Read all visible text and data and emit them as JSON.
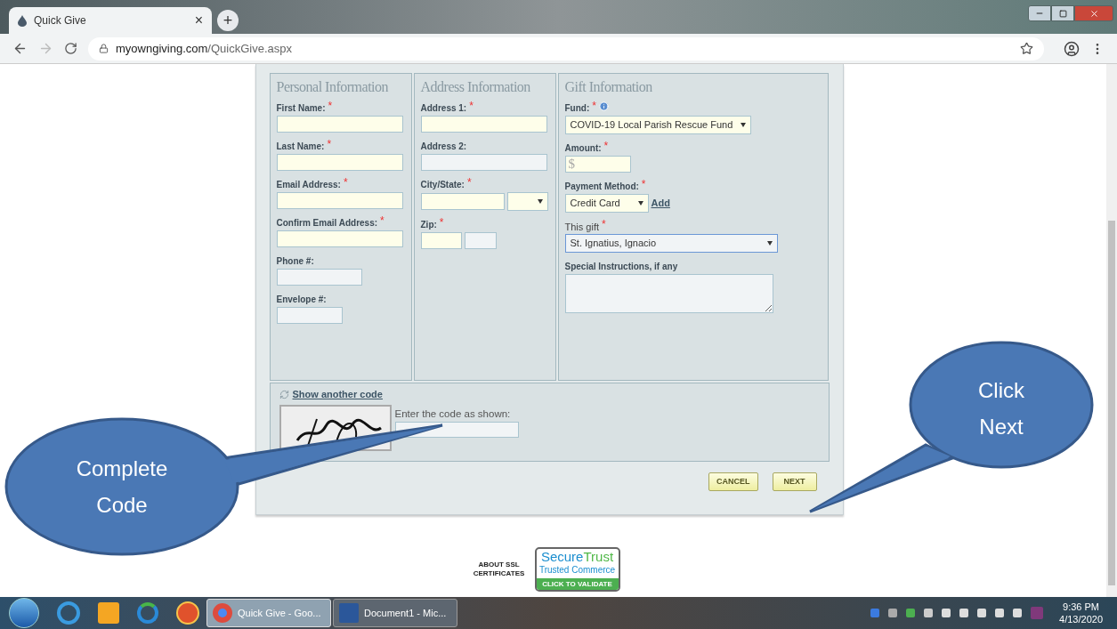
{
  "browser": {
    "tab": {
      "title": "Quick Give",
      "close": "×",
      "new_tab": "+"
    },
    "url": {
      "host": "myowngiving.com",
      "path": "/QuickGive.aspx"
    }
  },
  "sections": [
    {
      "title": "Personal Information",
      "fields": [
        {
          "label": "First Name:",
          "asterisk": "*",
          "bold": true,
          "controls": [
            {
              "kind": "wide",
              "required": true
            }
          ]
        },
        {
          "label": "Last Name:",
          "asterisk": "*",
          "bold": true,
          "controls": [
            {
              "kind": "wide",
              "required": true
            }
          ]
        },
        {
          "label": "Email Address:",
          "asterisk": "*",
          "bold": true,
          "controls": [
            {
              "kind": "wide",
              "required": true
            }
          ]
        },
        {
          "label": "Confirm Email Address:",
          "asterisk": "*",
          "bold": true,
          "controls": [
            {
              "kind": "wide",
              "required": true
            }
          ]
        },
        {
          "label": "Phone #:",
          "bold": true,
          "controls": [
            {
              "kind": "medium",
              "required": false
            }
          ]
        },
        {
          "label": "Envelope #:",
          "bold": true,
          "controls": [
            {
              "kind": "short",
              "required": false
            }
          ]
        }
      ]
    },
    {
      "title": "Address Information",
      "fields": [
        {
          "label": "Address 1:",
          "asterisk": "*",
          "bold": true,
          "controls": [
            {
              "kind": "wide",
              "required": true
            }
          ]
        },
        {
          "label": "Address 2:",
          "bold": true,
          "controls": [
            {
              "kind": "wide",
              "required": false
            }
          ]
        },
        {
          "label": "City/State:",
          "asterisk": "*",
          "bold": true,
          "controls": [
            {
              "kind": "city",
              "required": true
            },
            {
              "kind": "state",
              "required": true,
              "focused": false
            }
          ]
        },
        {
          "label": "Zip:",
          "asterisk": "*",
          "bold": true,
          "controls": [
            {
              "kind": "zip",
              "required": true
            },
            {
              "kind": "zip4",
              "required": false
            }
          ]
        }
      ]
    },
    {
      "title": "Gift Information",
      "fields": [
        {
          "label": "Fund:",
          "asterisk": "*",
          "bold": true,
          "info": true,
          "controls": [
            {
              "kind": "fund",
              "required": true,
              "value": "COVID-19 Local Parish Rescue Fund",
              "focused": false
            }
          ]
        },
        {
          "label": "Amount:",
          "asterisk": "*",
          "bold": true,
          "controls": [
            {
              "kind": "amount",
              "required": true,
              "placeholder": "$"
            }
          ]
        },
        {
          "label": "Payment Method:",
          "asterisk": "*",
          "bold": true,
          "controls": [
            {
              "kind": "payment",
              "required": true,
              "value": "Credit Card",
              "focused": false
            }
          ],
          "link": "Add"
        },
        {
          "label": "This gift",
          "asterisk": "*",
          "bold": false,
          "controls": [
            {
              "kind": "gift",
              "required": false,
              "value": "St. Ignatius, Ignacio",
              "focused": true
            }
          ]
        },
        {
          "label": "Special Instructions, if any",
          "bold": true,
          "controls": [
            {
              "kind": "notes",
              "required": false
            }
          ]
        }
      ]
    }
  ],
  "captcha": {
    "refresh_link": "Show another code",
    "prompt": "Enter the code as shown:"
  },
  "buttons": [
    "CANCEL",
    "NEXT"
  ],
  "ssl": {
    "about": "ABOUT SSL CERTIFICATES",
    "brand_a": "Secure",
    "brand_b": "Trust",
    "tagline": "Trusted Commerce",
    "cta": "CLICK TO VALIDATE"
  },
  "callouts": [
    "Complete Code",
    "Click Next"
  ],
  "taskbar": {
    "windows": [
      {
        "title": "Quick Give - Goo...",
        "kind": "chrome",
        "selected": true
      },
      {
        "title": "Document1 - Mic...",
        "kind": "word",
        "selected": false
      }
    ],
    "time": "9:36 PM",
    "date": "4/13/2020"
  }
}
